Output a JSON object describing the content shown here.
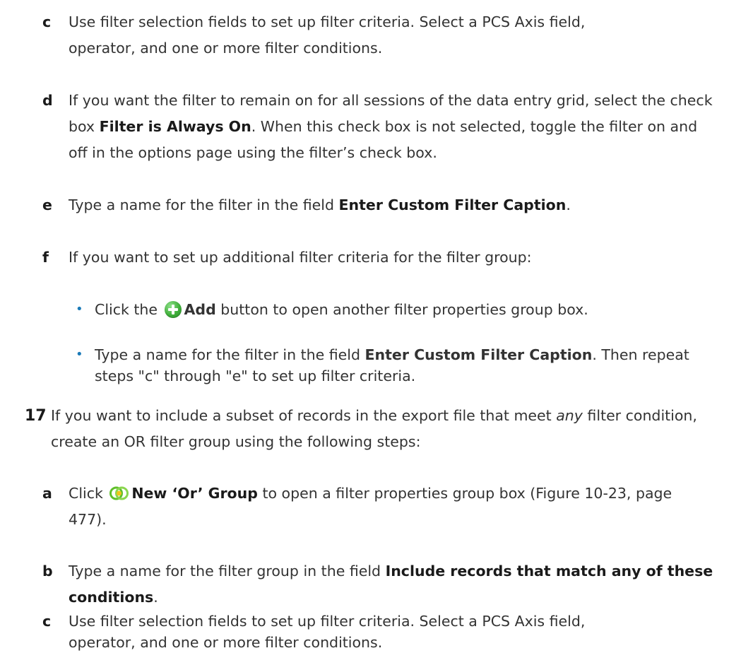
{
  "steps": {
    "c1": {
      "label": "c",
      "line1": "Use filter selection fields to set up filter criteria. Select a PCS Axis field,",
      "line2": "operator, and one or more filter conditions."
    },
    "d": {
      "label": "d",
      "pre": "If you want the filter to remain on for all sessions of the data entry grid, select the check box ",
      "bold": "Filter is Always On",
      "post": ". When this check box is not selected, toggle the filter on and off in the options page using the filter’s check box."
    },
    "e": {
      "label": "e",
      "pre": "Type a name for the filter in the field ",
      "bold": "Enter Custom Filter Caption",
      "post": "."
    },
    "f": {
      "label": "f",
      "text": "If you want to set up additional filter criteria for the filter group:"
    }
  },
  "bullets": {
    "b1": {
      "pre": "Click the ",
      "icon": "add-icon",
      "bold": "Add",
      "post": " button to open another filter properties group box."
    },
    "b2": {
      "pre": "Type a name for the filter in the field ",
      "bold": "Enter Custom Filter Caption",
      "post": ". Then repeat steps \"c\" through \"e\" to set up filter criteria."
    }
  },
  "step17": {
    "label": "17",
    "pre": "If you want to include a subset of records in the export file that meet ",
    "italic": "any",
    "post": " filter condition, create an OR filter group using the following steps:"
  },
  "sub17": {
    "a": {
      "label": "a",
      "pre": "Click ",
      "icon": "or-group-icon",
      "bold": "New ‘Or’ Group",
      "post": " to open a filter properties group box (Figure 10-23, page 477)."
    },
    "b": {
      "label": "b",
      "pre": "Type a name for the filter group in the field ",
      "bold": "Include records that match any of these conditions",
      "post": "."
    },
    "c": {
      "label": "c",
      "line1": "Use filter selection fields to set up filter criteria. Select a PCS Axis field,",
      "line2": "operator, and one or more filter conditions."
    }
  },
  "colors": {
    "text": "#333333",
    "bullet": "#1a7ab8",
    "add_icon": "#3fae3a",
    "or_icon": "#5fbf2a"
  }
}
